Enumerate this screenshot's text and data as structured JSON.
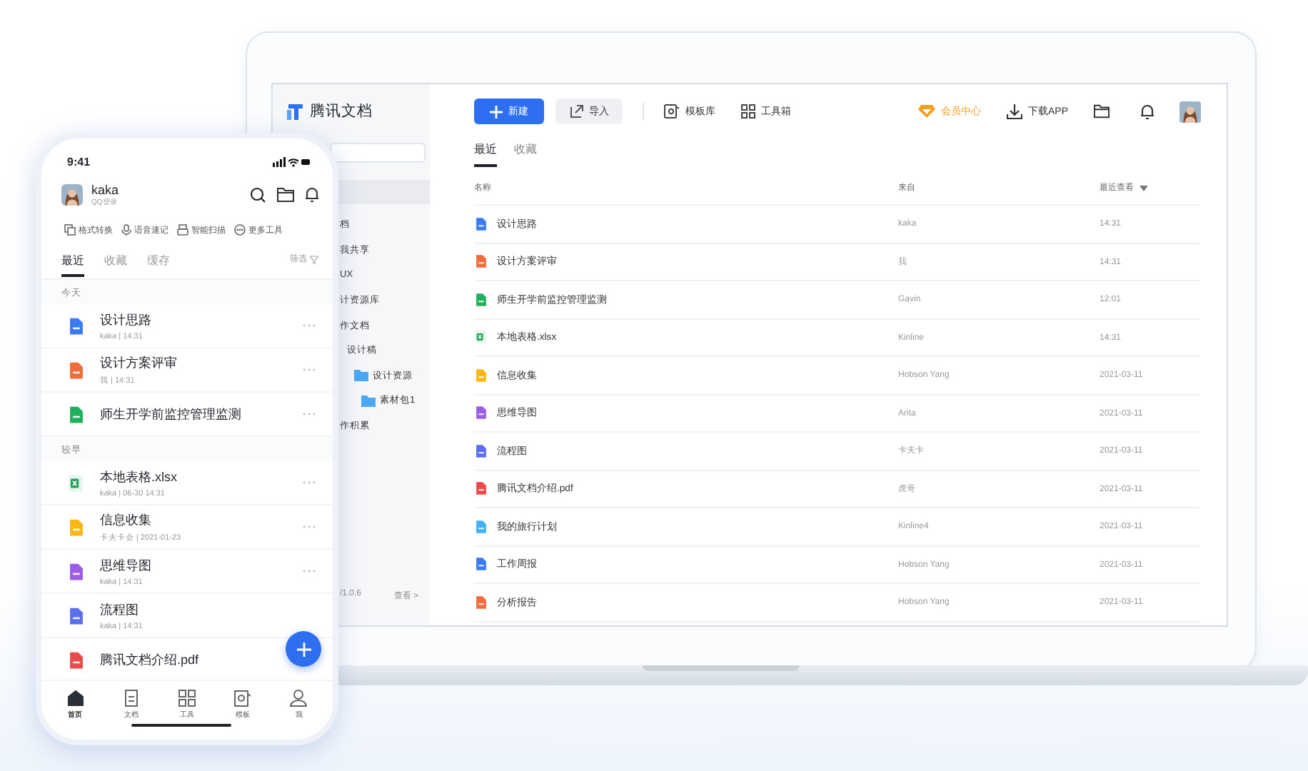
{
  "laptop": {
    "logo": "腾讯文档",
    "toolbar": {
      "new_button": "新建",
      "import_button": "导入",
      "links": [
        {
          "kind": "template",
          "label": "模板库"
        },
        {
          "kind": "toolbox",
          "label": "工具箱"
        }
      ],
      "member": "会员中心",
      "download": "下载APP"
    },
    "sidebar": {
      "items": [
        {
          "label": "档",
          "folder": false
        },
        {
          "label": "我共享",
          "folder": false
        },
        {
          "label": "UX",
          "folder": false
        },
        {
          "label": "计资源库",
          "folder": false
        },
        {
          "label": "作文档",
          "folder": false,
          "children": [
            {
              "label": "设计稿",
              "folder": false,
              "children": [
                {
                  "label": "设计资源",
                  "folder": true,
                  "children": [
                    {
                      "label": "素材包1",
                      "folder": true
                    }
                  ]
                }
              ]
            }
          ]
        },
        {
          "label": "作积累",
          "folder": false
        }
      ],
      "version": "/1.0.6",
      "view_link": "查看 >"
    },
    "tabs": [
      {
        "label": "最近",
        "selected": true
      },
      {
        "label": "收藏",
        "selected": false
      }
    ],
    "table": {
      "columns": [
        "名称",
        "来自",
        "最近查看"
      ],
      "rows": [
        {
          "kind": "doc",
          "name": "设计思路",
          "from": "kaka",
          "viewed": "14:31"
        },
        {
          "kind": "slide",
          "name": "设计方案评审",
          "from": "我",
          "viewed": "14:31"
        },
        {
          "kind": "sheet",
          "name": "师生开学前监控管理监测",
          "from": "Gavin",
          "viewed": "12:01"
        },
        {
          "kind": "excel",
          "name": "本地表格.xlsx",
          "from": "Kinline",
          "viewed": "14:31"
        },
        {
          "kind": "form",
          "name": "信息收集",
          "from": "Hobson Yang",
          "viewed": "2021-03-11"
        },
        {
          "kind": "mind",
          "name": "思维导图",
          "from": "Arita",
          "viewed": "2021-03-11"
        },
        {
          "kind": "flow",
          "name": "流程图",
          "from": "卡夫卡",
          "viewed": "2021-03-11"
        },
        {
          "kind": "pdf",
          "name": "腾讯文档介绍.pdf",
          "from": "虎哥",
          "viewed": "2021-03-11"
        },
        {
          "kind": "plan",
          "name": "我的旅行计划",
          "from": "Kinline4",
          "viewed": "2021-03-11"
        },
        {
          "kind": "doc",
          "name": "工作周报",
          "from": "Hobson Yang",
          "viewed": "2021-03-11"
        },
        {
          "kind": "slide",
          "name": "分析报告",
          "from": "Hobson Yang",
          "viewed": "2021-03-11"
        }
      ]
    }
  },
  "phone": {
    "time": "9:41",
    "user": {
      "name": "kaka",
      "login": "QQ登录"
    },
    "tools": [
      {
        "kind": "convert",
        "label": "格式转换"
      },
      {
        "kind": "voice",
        "label": "语音速记"
      },
      {
        "kind": "scan",
        "label": "智能扫描"
      },
      {
        "kind": "more",
        "label": "更多工具"
      }
    ],
    "tabs": [
      {
        "label": "最近",
        "selected": true
      },
      {
        "label": "收藏",
        "selected": false
      },
      {
        "label": "缓存",
        "selected": false
      }
    ],
    "filter": "筛选",
    "sections": [
      {
        "title": "今天",
        "files": [
          {
            "kind": "doc",
            "name": "设计思路",
            "meta": "kaka | 14:31",
            "more": true
          },
          {
            "kind": "slide",
            "name": "设计方案评审",
            "meta": "我 | 14:31",
            "more": true
          },
          {
            "kind": "sheet",
            "name": "师生开学前监控管理监测",
            "more": true
          }
        ]
      },
      {
        "title": "较早",
        "files": [
          {
            "kind": "excel",
            "name": "本地表格.xlsx",
            "meta": "kaka | 06-30 14:31",
            "more": true
          },
          {
            "kind": "form",
            "name": "信息收集",
            "meta": "卡夫卡会 | 2021-01-23",
            "more": true
          },
          {
            "kind": "mind",
            "name": "思维导图",
            "meta": "kaka | 14:31",
            "more": true
          },
          {
            "kind": "flow",
            "name": "流程图",
            "meta": "kaka | 14:31",
            "more": false
          },
          {
            "kind": "pdf",
            "name": "腾讯文档介绍.pdf",
            "more": false
          }
        ]
      }
    ],
    "nav": [
      {
        "kind": "home",
        "label": "首页",
        "selected": true
      },
      {
        "kind": "docs",
        "label": "文档",
        "selected": false
      },
      {
        "kind": "tools",
        "label": "工具",
        "selected": false
      },
      {
        "kind": "templates",
        "label": "模板",
        "selected": false
      },
      {
        "kind": "me",
        "label": "我",
        "selected": false
      }
    ]
  }
}
